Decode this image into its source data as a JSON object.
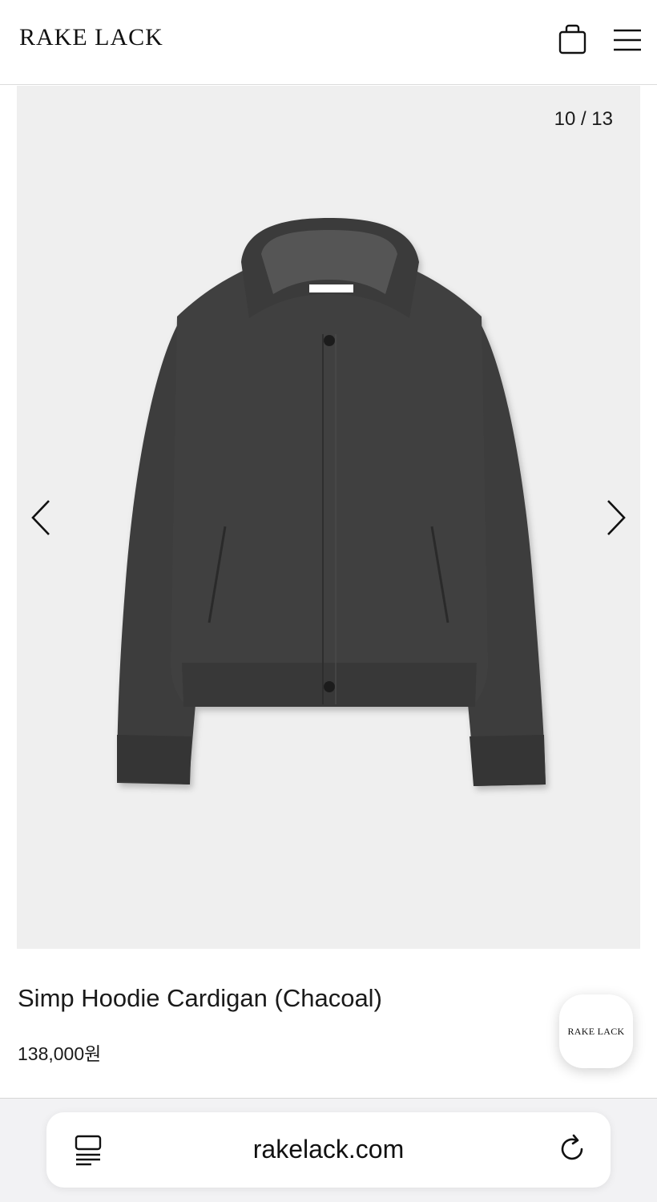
{
  "header": {
    "logo": "RAKE LACK",
    "bag_icon": "shopping-bag-icon",
    "menu_icon": "hamburger-menu-icon"
  },
  "gallery": {
    "counter": "10 / 13",
    "current_index": 10,
    "total": 13,
    "prev_icon": "chevron-left-icon",
    "next_icon": "chevron-right-icon",
    "image_subject": "charcoal hooded cardigan",
    "background_color": "#efefef",
    "garment_color": "#3f3f3f"
  },
  "product": {
    "name": "Simp Hoodie Cardigan (Chacoal)",
    "price": "138,000원"
  },
  "floating_button": {
    "label": "RAKE LACK"
  },
  "browser": {
    "url": "rakelack.com",
    "reader_icon": "reader-mode-icon",
    "reload_icon": "reload-icon"
  }
}
